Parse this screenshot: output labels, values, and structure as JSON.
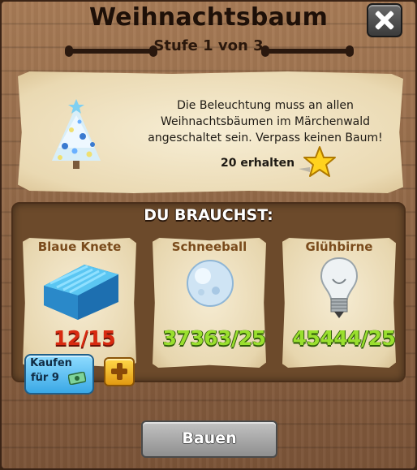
{
  "dialog": {
    "title": "Weihnachtsbaum",
    "level": "Stufe 1 von 3"
  },
  "info": {
    "description": "Die Beleuchtung muss an allen Weihnachtsbäumen im Märchenwald angeschaltet sein. Verpass keinen Baum!",
    "reward_label": "20 erhalten",
    "reward_icon": "star-icon",
    "preview_icon": "christmas-tree-icon"
  },
  "requirements": {
    "heading": "DU BRAUCHST:",
    "items": [
      {
        "name": "Blaue Knete",
        "progress": "12/15",
        "icon": "blue-clay-icon",
        "status": "missing"
      },
      {
        "name": "Schneeball",
        "progress": "37363/25",
        "icon": "snowball-icon",
        "status": "complete"
      },
      {
        "name": "Glühbirne",
        "progress": "45444/25",
        "icon": "light-bulb-icon",
        "status": "complete"
      }
    ],
    "buy": {
      "label": "Kaufen",
      "price": "für 9",
      "currency_icon": "money-bill-icon"
    }
  },
  "actions": {
    "build_label": "Bauen"
  },
  "colors": {
    "missing": "#d82a10",
    "complete": "#9adf2e",
    "buy_button": "#3aa8e6",
    "plus_button": "#e29a12"
  }
}
